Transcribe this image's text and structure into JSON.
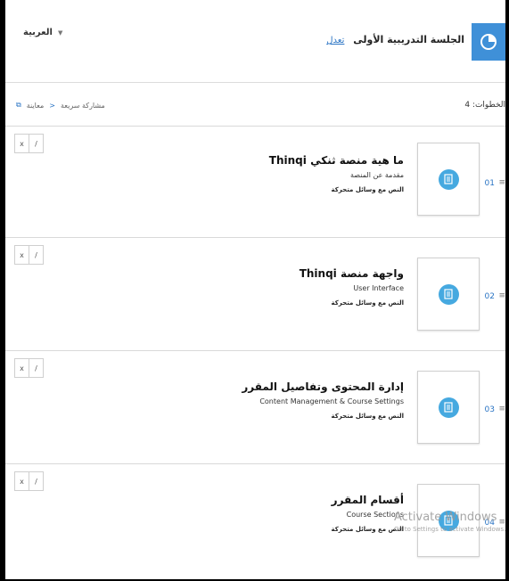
{
  "header": {
    "session_title": "الجلسة التدريبية الأولى",
    "edit_label": "تعدل",
    "language": "العربية",
    "language_caret": "▼"
  },
  "toolbar": {
    "steps_label": "الخطوات: 4",
    "quick_share_label": "مشاركة سريعة",
    "preview_label": "معاينة",
    "share_icon_glyph": "<",
    "preview_icon_glyph": "⧉"
  },
  "row_actions": {
    "delete_glyph": "x",
    "edit_glyph": "/"
  },
  "steps": [
    {
      "number": "01",
      "title": "ما هية منصة ثنكي Thinqi",
      "subtitle": "مقدمة عن المنصة",
      "kind": "النص مع وسائل متحركة"
    },
    {
      "number": "02",
      "title": "واجهة منصة Thinqi",
      "subtitle": "User Interface",
      "kind": "النص مع وسائل متحركة"
    },
    {
      "number": "03",
      "title": "إدارة المحتوى وتفاصيل المقرر",
      "subtitle": "Content Management & Course Settings",
      "kind": "النص مع وسائل متحركة"
    },
    {
      "number": "04",
      "title": "أقسام المقرر",
      "subtitle": "Course Sections",
      "kind": "النص مع وسائل متحركة"
    }
  ],
  "drag_glyph": "≡",
  "watermark": {
    "line1": "Activate Windows",
    "line2": "Go to Settings to activate Windows."
  },
  "colors": {
    "accent_blue": "#3f90d8",
    "thumb_dot": "#46a9e0",
    "link_blue": "#2a74c4"
  }
}
